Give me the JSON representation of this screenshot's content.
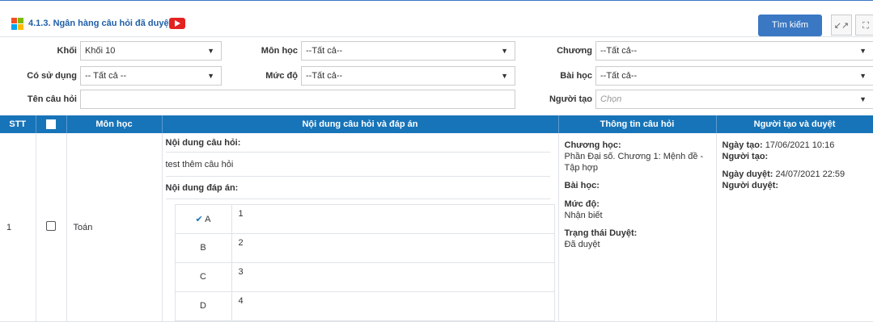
{
  "title": "4.1.3. Ngân hàng câu hỏi đã duyệt",
  "toolbar": {
    "search_label": "Tìm kiếm",
    "collapse_symbol": "↙↗",
    "fullscreen_symbol": "⛶"
  },
  "filters": {
    "khoi": {
      "label": "Khối",
      "value": "Khối 10"
    },
    "mon_hoc": {
      "label": "Môn học",
      "value": "--Tất cả--"
    },
    "chuong": {
      "label": "Chương",
      "value": "--Tất cả--"
    },
    "co_su_dung": {
      "label": "Có sử dụng",
      "value": "-- Tất cả --"
    },
    "muc_do": {
      "label": "Mức độ",
      "value": "--Tất cả--"
    },
    "bai_hoc": {
      "label": "Bài học",
      "value": "--Tất cả--"
    },
    "ten_cau_hoi": {
      "label": "Tên câu hỏi",
      "value": ""
    },
    "nguoi_tao": {
      "label": "Người tạo",
      "placeholder": "Chọn"
    }
  },
  "table": {
    "headers": {
      "stt": "STT",
      "mon_hoc": "Môn học",
      "noi_dung": "Nội dung câu hỏi và đáp án",
      "thong_tin": "Thông tin câu hỏi",
      "nguoi_tao_duyet": "Người tạo và duyệt"
    },
    "rows": [
      {
        "stt": "1",
        "mon_hoc": "Toán",
        "question_label": "Nội dung câu hỏi:",
        "question_text": "test thêm câu hỏi",
        "answer_label": "Nội dung đáp án:",
        "answers": [
          {
            "letter": "A",
            "value": "1",
            "correct": true
          },
          {
            "letter": "B",
            "value": "2",
            "correct": false
          },
          {
            "letter": "C",
            "value": "3",
            "correct": false
          },
          {
            "letter": "D",
            "value": "4",
            "correct": false
          }
        ],
        "info": {
          "chuong_label": "Chương học:",
          "chuong_value": "Phần Đại số. Chương 1: Mệnh đề - Tập hợp",
          "bai_hoc_label": "Bài học:",
          "muc_do_label": "Mức độ:",
          "muc_do_value": "Nhận biết",
          "trang_thai_label": "Trạng thái Duyệt:",
          "trang_thai_value": "Đã duyệt"
        },
        "creator": {
          "ngay_tao_label": "Ngày tạo:",
          "ngay_tao_value": "17/06/2021 10:16",
          "nguoi_tao_label": "Người tạo:",
          "ngay_duyet_label": "Ngày duyệt:",
          "ngay_duyet_value": "24/07/2021 22:59",
          "nguoi_duyet_label": "Người duyệt:"
        }
      }
    ]
  },
  "colors": {
    "accent": "#1874b8",
    "button": "#3a78c3",
    "youtube": "#e32322"
  }
}
